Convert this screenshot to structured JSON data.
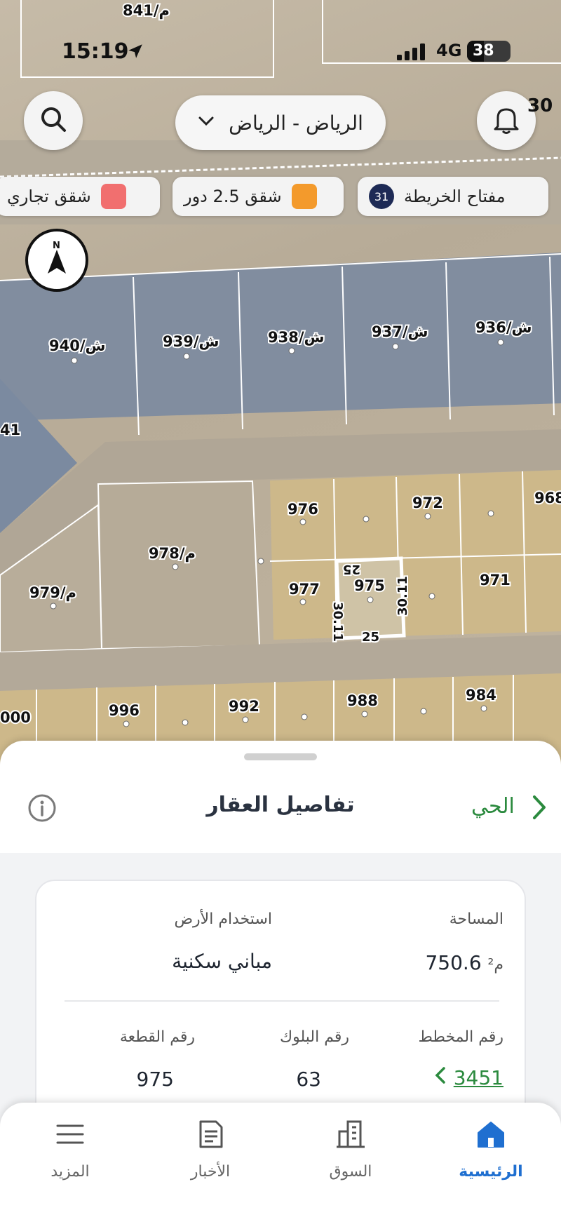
{
  "status_bar": {
    "time": "15:19",
    "network": "4G",
    "battery": "38"
  },
  "header": {
    "city_label": "الرياض - الرياض",
    "bell_badge": "30"
  },
  "legend": {
    "chips": [
      {
        "label": "مفتاح الخريطة",
        "badge": "31"
      },
      {
        "label": "شقق 2.5 دور",
        "color": "#f39a2c"
      },
      {
        "label": "شقق تجاري",
        "color": "#f16f6f"
      }
    ]
  },
  "map": {
    "plots": [
      "841/م",
      "940/ش",
      "939/ش",
      "938/ش",
      "937/ش",
      "936/ش",
      "41",
      "976",
      "972",
      "968",
      "978/م",
      "979/م",
      "977",
      "975",
      "971",
      "000",
      "996",
      "992",
      "988",
      "984"
    ],
    "dimensions": [
      "25",
      "30.11",
      "30.11",
      "25"
    ]
  },
  "sheet": {
    "title": "تفاصيل العقار",
    "neighborhood_link": "الحي",
    "area_label": "المساحة",
    "area_value": "750.6",
    "area_unit": "م²",
    "land_use_label": "استخدام الأرض",
    "land_use_value": "مباني سكنية",
    "plan_label": "رقم المخطط",
    "plan_value": "3451",
    "block_label": "رقم البلوك",
    "block_value": "63",
    "plot_label": "رقم القطعة",
    "plot_value": "975"
  },
  "tabbar": {
    "tabs": [
      {
        "label": "الرئيسية",
        "icon": "home-icon",
        "active": true
      },
      {
        "label": "السوق",
        "icon": "building-icon"
      },
      {
        "label": "الأخبار",
        "icon": "news-icon"
      },
      {
        "label": "المزيد",
        "icon": "menu-icon"
      }
    ]
  },
  "colors": {
    "accent": "#1f6fd0",
    "link_green": "#2b8a3e",
    "residential": "#cdb88a",
    "commercial_blue": "#7f8ea3"
  }
}
